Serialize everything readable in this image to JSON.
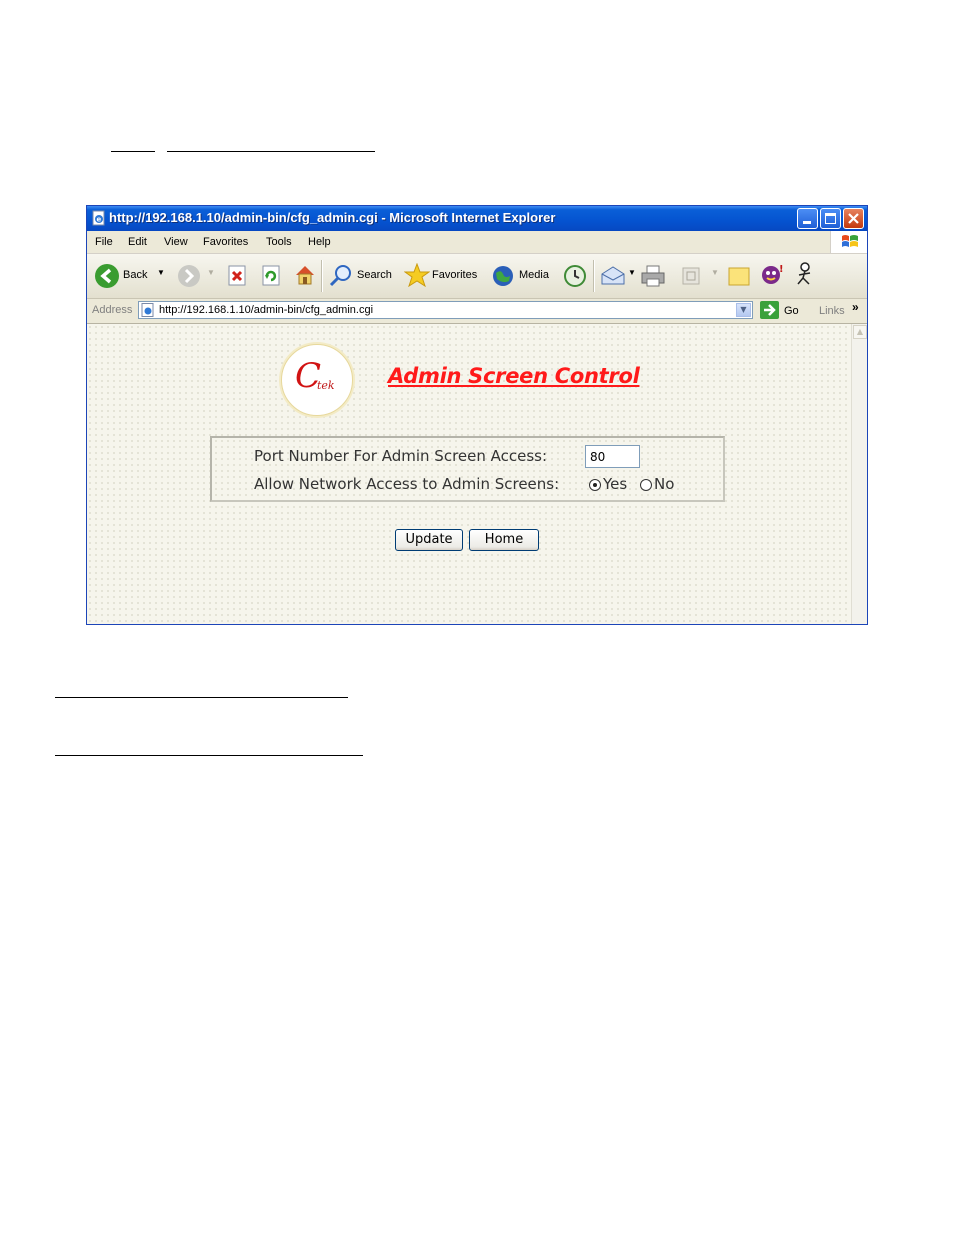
{
  "document": {
    "underlines": [
      "",
      "",
      "",
      ""
    ]
  },
  "window": {
    "title": "http://192.168.1.10/admin-bin/cfg_admin.cgi - Microsoft Internet Explorer",
    "menu": [
      "File",
      "Edit",
      "View",
      "Favorites",
      "Tools",
      "Help"
    ],
    "toolbar": {
      "back": "Back",
      "search": "Search",
      "favorites": "Favorites",
      "media": "Media"
    },
    "address": {
      "label": "Address",
      "url": "http://192.168.1.10/admin-bin/cfg_admin.cgi",
      "go": "Go",
      "links": "Links",
      "links_chevron": "»"
    }
  },
  "page": {
    "logo_text": "C",
    "logo_subtext": "tek",
    "title": "Admin Screen Control",
    "port_label": "Port Number For Admin Screen Access:",
    "port_value": "80",
    "network_label": "Allow Network Access to Admin Screens:",
    "radio_yes": "Yes",
    "radio_no": "No",
    "selected": "Yes",
    "update_button": "Update",
    "home_button": "Home"
  },
  "colors": {
    "title_red": "#ff1a1a",
    "xp_titlebar_blue": "#0553d0"
  }
}
